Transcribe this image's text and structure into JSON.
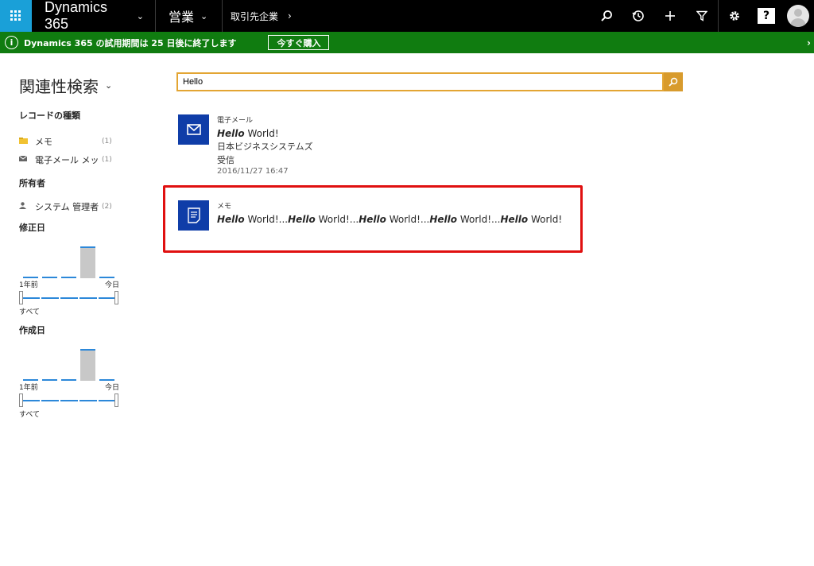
{
  "nav": {
    "app_name": "Dynamics 365",
    "area": "営業",
    "breadcrumb": "取引先企業",
    "help_label": "?"
  },
  "banner": {
    "message": "Dynamics 365 の試用期間は 25 日後に終了します",
    "buy_label": "今すぐ購入"
  },
  "filters": {
    "title": "関連性検索",
    "record_types_heading": "レコードの種類",
    "record_types": [
      {
        "label": "メモ",
        "count": "(1)"
      },
      {
        "label": "電子メール メッ...",
        "count": "(1)"
      }
    ],
    "owner_heading": "所有者",
    "owners": [
      {
        "label": "システム 管理者",
        "count": "(2)"
      }
    ],
    "modified_heading": "修正日",
    "modified_range": {
      "start": "1年前",
      "end": "今日",
      "all": "すべて"
    },
    "created_heading": "作成日",
    "created_range": {
      "start": "1年前",
      "end": "今日",
      "all": "すべて"
    }
  },
  "search": {
    "value": "Hello"
  },
  "results": [
    {
      "type": "電子メール",
      "title_bold": "Hello",
      "title_rest": " World!",
      "company": "日本ビジネスシステムズ",
      "direction": "受信",
      "date": "2016/11/27 16:47"
    },
    {
      "type": "メモ",
      "snippet_bold": "Hello",
      "snippet_rest_1": " World!...",
      "snippet_rest_2": " World!...",
      "snippet_rest_3": " World!...",
      "snippet_rest_4": " World!...",
      "snippet_rest_5": " World!"
    }
  ],
  "colors": {
    "nav_bg": "#000000",
    "waffle": "#1aa0d8",
    "banner": "#107c10",
    "search_border": "#e3a533",
    "search_button": "#d89b2d",
    "result_icon": "#0f3da8",
    "highlight": "#e01010",
    "histogram": "#2c88d9"
  }
}
